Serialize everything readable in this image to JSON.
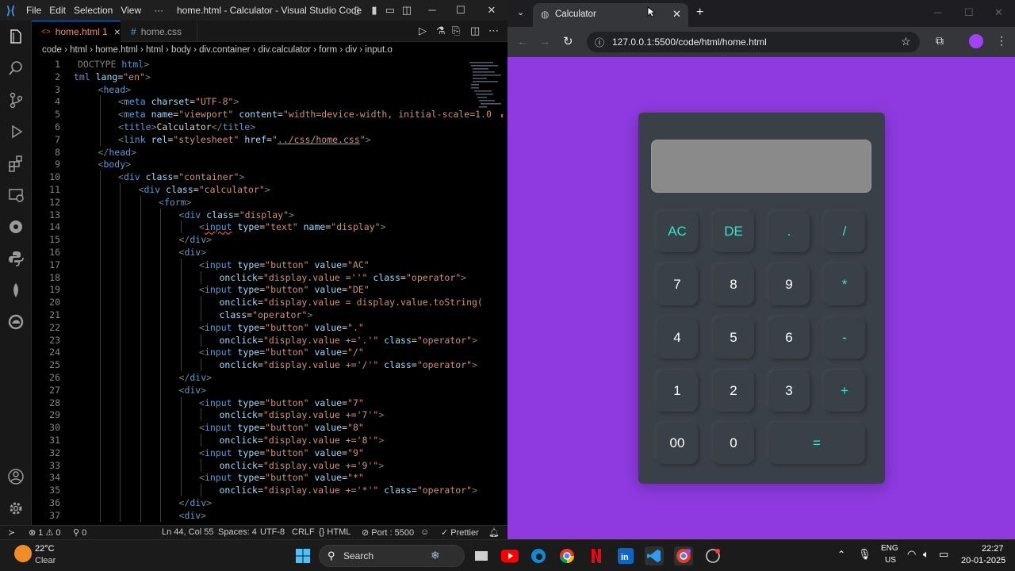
{
  "vscode": {
    "menu": [
      "File",
      "Edit",
      "Selection",
      "View",
      "···"
    ],
    "title": "home.html - Calculator - Visual Studio Code",
    "tabs": [
      {
        "label": "home.html 1",
        "icon": "html-icon"
      },
      {
        "label": "home.css",
        "icon": "css-hash-icon"
      }
    ],
    "tab_close": "×",
    "breadcrumbs": "code › html › home.html › html › body › div.container › div.calculator › form › div › input.o",
    "code": [
      {
        "n": "1",
        "html": "<span class='g'>DOCTYPE</span> <span class='t'>html</span><span class='g'>&gt;</span>",
        "indent": 0
      },
      {
        "n": "2",
        "html": "<span class='t'>tml</span> <span class='a'>lang</span><span class='w'>=</span><span class='s'>\"en\"</span><span class='g'>&gt;</span>",
        "indent": -0.2
      },
      {
        "n": "3",
        "html": "<span class='g'>&lt;</span><span class='t'>head</span><span class='g'>&gt;</span>",
        "indent": 1
      },
      {
        "n": "4",
        "html": "<span class='g'>&lt;</span><span class='t'>meta</span> <span class='a'>charset</span><span class='w'>=</span><span class='s'>\"UTF-8\"</span><span class='g'>&gt;</span>",
        "indent": 2
      },
      {
        "n": "5",
        "html": "<span class='g'>&lt;</span><span class='t'>meta</span> <span class='a'>name</span><span class='w'>=</span><span class='s'>\"viewport\"</span> <span class='a'>content</span><span class='w'>=</span><span class='s'>\"width=device-width, initial-scale=1.0</span>",
        "indent": 2
      },
      {
        "n": "6",
        "html": "<span class='g'>&lt;</span><span class='t'>title</span><span class='g'>&gt;</span><span class='w'>Calculator</span><span class='g'>&lt;/</span><span class='t'>title</span><span class='g'>&gt;</span>",
        "indent": 2
      },
      {
        "n": "7",
        "html": "<span class='g'>&lt;</span><span class='t'>link</span> <span class='a'>rel</span><span class='w'>=</span><span class='s'>\"stylesheet\"</span> <span class='a'>href</span><span class='w'>=</span><span class='s'>\"<u>../css/home.css</u>\"</span><span class='g'>&gt;</span>",
        "indent": 2
      },
      {
        "n": "8",
        "html": "<span class='g'>&lt;/</span><span class='t'>head</span><span class='g'>&gt;</span>",
        "indent": 1
      },
      {
        "n": "9",
        "html": "<span class='g'>&lt;</span><span class='t'>body</span><span class='g'>&gt;</span>",
        "indent": 1
      },
      {
        "n": "10",
        "html": "<span class='g'>&lt;</span><span class='t'>div</span> <span class='a'>class</span><span class='w'>=</span><span class='s'>\"container\"</span><span class='g'>&gt;</span>",
        "indent": 2
      },
      {
        "n": "11",
        "html": "<span class='g'>&lt;</span><span class='t'>div</span> <span class='a'>class</span><span class='w'>=</span><span class='s'>\"calculator\"</span><span class='g'>&gt;</span>",
        "indent": 3
      },
      {
        "n": "12",
        "html": "<span class='g'>&lt;</span><span class='t'>form</span><span class='g'>&gt;</span>",
        "indent": 4
      },
      {
        "n": "13",
        "html": "<span class='g'>&lt;</span><span class='t'>div</span> <span class='a'>class</span><span class='w'>=</span><span class='s'>\"display\"</span><span class='g'>&gt;</span>",
        "indent": 5
      },
      {
        "n": "14",
        "html": "<span class='g'>&lt;</span><span class='t' style='text-decoration:underline wavy #f14c4c'>input</span> <span class='a'>type</span><span class='w'>=</span><span class='s'>\"text\"</span> <span class='a'>name</span><span class='w'>=</span><span class='s'>\"display\"</span><span class='g'>&gt;</span>",
        "indent": 6
      },
      {
        "n": "15",
        "html": "<span class='g'>&lt;/</span><span class='t'>div</span><span class='g'>&gt;</span>",
        "indent": 5
      },
      {
        "n": "16",
        "html": "<span class='g'>&lt;</span><span class='t'>div</span><span class='g'>&gt;</span>",
        "indent": 5
      },
      {
        "n": "17",
        "html": "<span class='g'>&lt;</span><span class='t'>input</span> <span class='a'>type</span><span class='w'>=</span><span class='s'>\"button\"</span> <span class='a'>value</span><span class='w'>=</span><span class='s'>\"AC\"</span>",
        "indent": 6
      },
      {
        "n": "18",
        "html": "<span class='a'>onclick</span><span class='w'>=</span><span class='s'>\"display.value =''\"</span> <span class='a'>class</span><span class='w'>=</span><span class='s'>\"operator\"</span><span class='g'>&gt;</span>",
        "indent": 7
      },
      {
        "n": "19",
        "html": "<span class='g'>&lt;</span><span class='t'>input</span> <span class='a'>type</span><span class='w'>=</span><span class='s'>\"button\"</span> <span class='a'>value</span><span class='w'>=</span><span class='s'>\"DE\"</span>",
        "indent": 6
      },
      {
        "n": "20",
        "html": "<span class='a'>onclick</span><span class='w'>=</span><span class='s'>\"display.value = display.value.toString(</span>",
        "indent": 7
      },
      {
        "n": "21",
        "html": "<span class='a'>class</span><span class='w'>=</span><span class='s'>\"operator\"</span><span class='g'>&gt;</span>",
        "indent": 7
      },
      {
        "n": "22",
        "html": "<span class='g'>&lt;</span><span class='t'>input</span> <span class='a'>type</span><span class='w'>=</span><span class='s'>\"button\"</span> <span class='a'>value</span><span class='w'>=</span><span class='s'>\".\"</span>",
        "indent": 6
      },
      {
        "n": "23",
        "html": "<span class='a'>onclick</span><span class='w'>=</span><span class='s'>\"display.value +='.'\"</span> <span class='a'>class</span><span class='w'>=</span><span class='s'>\"operator\"</span><span class='g'>&gt;</span>",
        "indent": 7
      },
      {
        "n": "24",
        "html": "<span class='g'>&lt;</span><span class='t'>input</span> <span class='a'>type</span><span class='w'>=</span><span class='s'>\"button\"</span> <span class='a'>value</span><span class='w'>=</span><span class='s'>\"/\"</span>",
        "indent": 6
      },
      {
        "n": "25",
        "html": "<span class='a'>onclick</span><span class='w'>=</span><span class='s'>\"display.value +='/'\"</span> <span class='a'>class</span><span class='w'>=</span><span class='s'>\"operator\"</span><span class='g'>&gt;</span>",
        "indent": 7
      },
      {
        "n": "26",
        "html": "<span class='g'>&lt;/</span><span class='t'>div</span><span class='g'>&gt;</span>",
        "indent": 5
      },
      {
        "n": "27",
        "html": "<span class='g'>&lt;</span><span class='t'>div</span><span class='g'>&gt;</span>",
        "indent": 5
      },
      {
        "n": "28",
        "html": "<span class='g'>&lt;</span><span class='t'>input</span> <span class='a'>type</span><span class='w'>=</span><span class='s'>\"button\"</span> <span class='a'>value</span><span class='w'>=</span><span class='s'>\"7\"</span>",
        "indent": 6
      },
      {
        "n": "29",
        "html": "<span class='a'>onclick</span><span class='w'>=</span><span class='s'>\"display.value +='7'\"</span><span class='g'>&gt;</span>",
        "indent": 7
      },
      {
        "n": "30",
        "html": "<span class='g'>&lt;</span><span class='t'>input</span> <span class='a'>type</span><span class='w'>=</span><span class='s'>\"button\"</span> <span class='a'>value</span><span class='w'>=</span><span class='s'>\"8\"</span>",
        "indent": 6
      },
      {
        "n": "31",
        "html": "<span class='a'>onclick</span><span class='w'>=</span><span class='s'>\"display.value +='8'\"</span><span class='g'>&gt;</span>",
        "indent": 7
      },
      {
        "n": "32",
        "html": "<span class='g'>&lt;</span><span class='t'>input</span> <span class='a'>type</span><span class='w'>=</span><span class='s'>\"button\"</span> <span class='a'>value</span><span class='w'>=</span><span class='s'>\"9\"</span>",
        "indent": 6
      },
      {
        "n": "33",
        "html": "<span class='a'>onclick</span><span class='w'>=</span><span class='s'>\"display.value +='9'\"</span><span class='g'>&gt;</span>",
        "indent": 7
      },
      {
        "n": "34",
        "html": "<span class='g'>&lt;</span><span class='t'>input</span> <span class='a'>type</span><span class='w'>=</span><span class='s'>\"button\"</span> <span class='a'>value</span><span class='w'>=</span><span class='s'>\"*\"</span>",
        "indent": 6
      },
      {
        "n": "35",
        "html": "<span class='a'>onclick</span><span class='w'>=</span><span class='s'>\"display.value +='*'\"</span> <span class='a'>class</span><span class='w'>=</span><span class='s'>\"operator\"</span><span class='g'>&gt;</span>",
        "indent": 7
      },
      {
        "n": "36",
        "html": "<span class='g'>&lt;/</span><span class='t'>div</span><span class='g'>&gt;</span>",
        "indent": 5
      },
      {
        "n": "37",
        "html": "<span class='g'>&lt;</span><span class='t'>div</span><span class='g'>&gt;</span>",
        "indent": 5
      }
    ],
    "status": {
      "errors": "⊗ 1 ⚠ 0",
      "ports": "⚲ 0",
      "position": "Ln 44, Col 55",
      "spaces": "Spaces: 4",
      "encoding": "UTF-8",
      "eol": "CRLF",
      "language": "{} HTML",
      "port": "⊘ Port : 5500",
      "prettier": "✓ Prettier"
    }
  },
  "chrome": {
    "tab_title": "Calculator",
    "url": "127.0.0.1:5500/code/html/home.html",
    "calculator": {
      "display_value": "",
      "keys": [
        [
          {
            "label": "AC",
            "op": true
          },
          {
            "label": "DE",
            "op": true
          },
          {
            "label": ".",
            "op": true
          },
          {
            "label": "/",
            "op": true
          }
        ],
        [
          {
            "label": "7",
            "op": false
          },
          {
            "label": "8",
            "op": false
          },
          {
            "label": "9",
            "op": false
          },
          {
            "label": "*",
            "op": true
          }
        ],
        [
          {
            "label": "4",
            "op": false
          },
          {
            "label": "5",
            "op": false
          },
          {
            "label": "6",
            "op": false
          },
          {
            "label": "-",
            "op": true
          }
        ],
        [
          {
            "label": "1",
            "op": false
          },
          {
            "label": "2",
            "op": false
          },
          {
            "label": "3",
            "op": false
          },
          {
            "label": "+",
            "op": true
          }
        ],
        [
          {
            "label": "00",
            "op": false
          },
          {
            "label": "0",
            "op": false
          },
          {
            "label": "=",
            "op": true,
            "wide": true
          }
        ]
      ],
      "colors": {
        "operator": "#2ee6c9",
        "body": "#3a4047",
        "page": "#8e3ae0",
        "display": "#8a8a8a"
      }
    }
  },
  "taskbar": {
    "weather_temp": "22°C",
    "weather_desc": "Clear",
    "search": "Search",
    "lang1": "ENG",
    "lang2": "US",
    "time": "22:27",
    "date": "20-01-2025"
  }
}
